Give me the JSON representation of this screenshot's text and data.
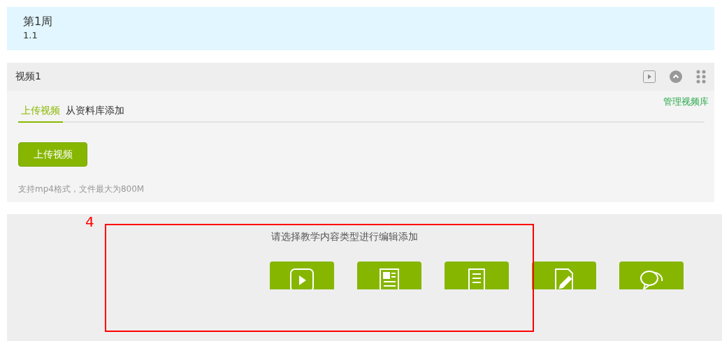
{
  "week": {
    "title": "第1周",
    "subtitle": "1.1"
  },
  "video_section": {
    "title": "视频1",
    "tabs": [
      {
        "label": "上传视频",
        "selected": true
      },
      {
        "label": "从资料库添加",
        "selected": false
      }
    ],
    "manage_link": "管理视频库",
    "upload_button": "上传视频",
    "hint": "支持mp4格式，文件最大为800M"
  },
  "content_picker": {
    "prompt": "请选择教学内容类型进行编辑添加",
    "tiles": [
      {
        "kind": "video"
      },
      {
        "kind": "article"
      },
      {
        "kind": "document"
      },
      {
        "kind": "edit"
      },
      {
        "kind": "discussion"
      }
    ]
  },
  "annotation": {
    "label": "4"
  }
}
